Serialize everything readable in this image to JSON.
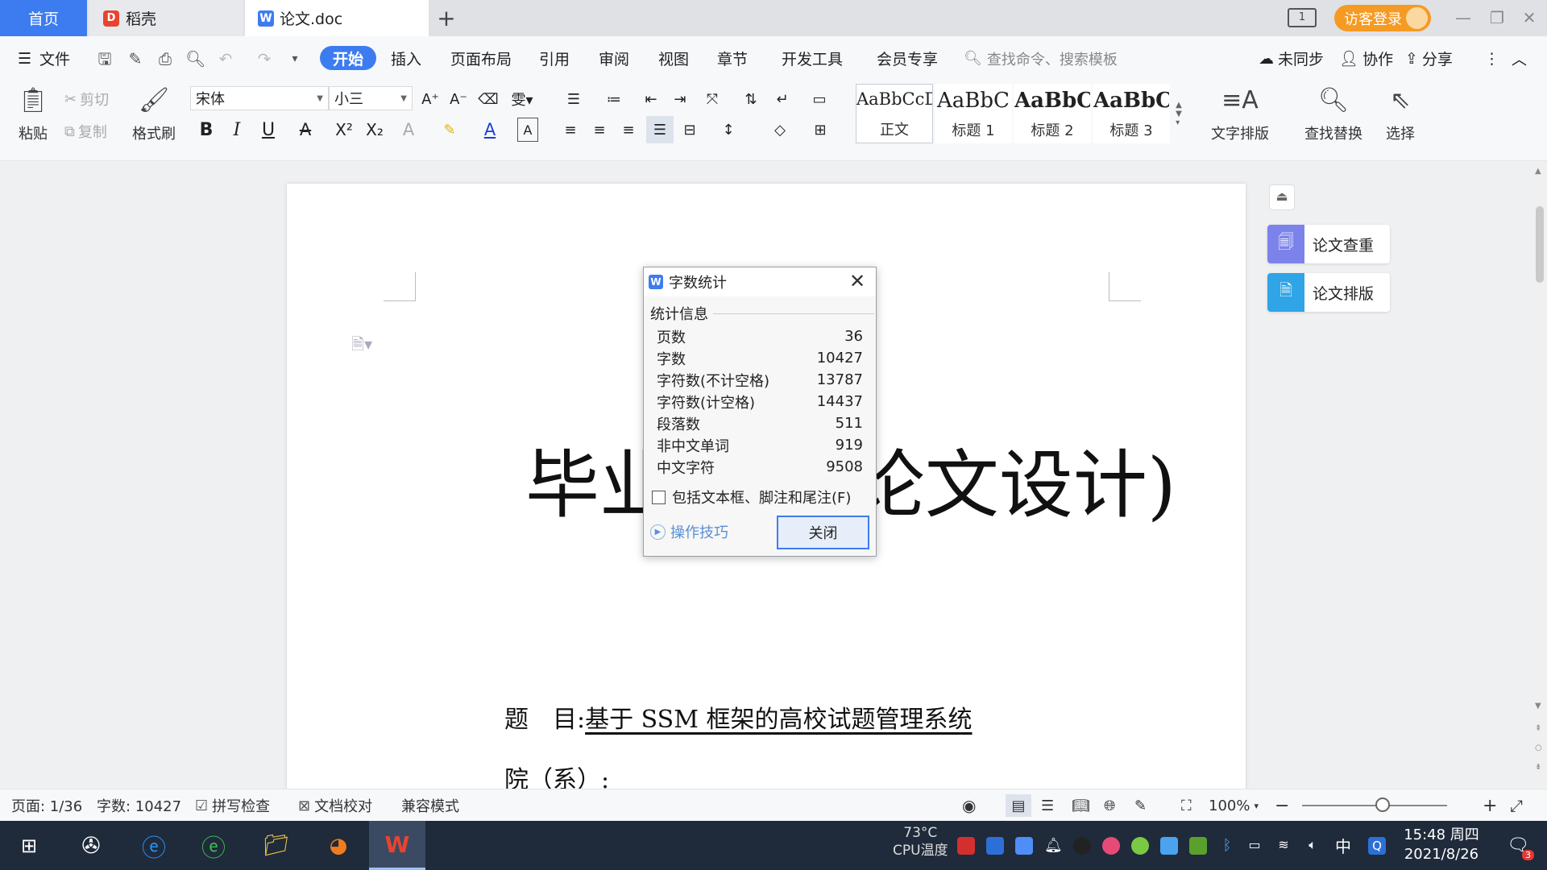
{
  "tabs": {
    "home": "首页",
    "daoke": "稻壳",
    "doc": "论文.doc"
  },
  "window": {
    "layout_label": "1",
    "visitor_login": "访客登录"
  },
  "menu": {
    "file": "文件",
    "items": [
      "开始",
      "插入",
      "页面布局",
      "引用",
      "审阅",
      "视图",
      "章节",
      "开发工具",
      "会员专享"
    ],
    "search_placeholder": "查找命令、搜索模板",
    "unsynced": "未同步",
    "collab": "协作",
    "share": "分享"
  },
  "ribbon": {
    "paste": "粘贴",
    "cut": "剪切",
    "copy": "复制",
    "format_painter": "格式刷",
    "font_name": "宋体",
    "font_size": "小三",
    "styles": [
      {
        "preview": "AaBbCcDd",
        "label": "正文"
      },
      {
        "preview": "AaBbC",
        "label": "标题 1"
      },
      {
        "preview": "AaBbC",
        "label": "标题 2"
      },
      {
        "preview": "AaBbC",
        "label": "标题 3"
      }
    ],
    "text_layout": "文字排版",
    "find_replace": "查找替换",
    "select": "选择"
  },
  "document": {
    "title": "毕业设计(论文设计)",
    "topic_label": "题　目:",
    "topic_value": "基于 SSM 框架的高校试题管理系统",
    "dept_label": "院（系）:",
    "dept_value": ""
  },
  "side_panel": {
    "check": "论文查重",
    "format": "论文排版"
  },
  "dialog": {
    "title": "字数统计",
    "group_label": "统计信息",
    "stats": [
      {
        "label": "页数",
        "value": "36"
      },
      {
        "label": "字数",
        "value": "10427"
      },
      {
        "label": "字符数(不计空格)",
        "value": "13787"
      },
      {
        "label": "字符数(计空格)",
        "value": "14437"
      },
      {
        "label": "段落数",
        "value": "511"
      },
      {
        "label": "非中文单词",
        "value": "919"
      },
      {
        "label": "中文字符",
        "value": "9508"
      }
    ],
    "include_label": "包括文本框、脚注和尾注(F)",
    "tips": "操作技巧",
    "close_button": "关闭"
  },
  "status": {
    "page": "页面: 1/36",
    "words": "字数: 10427",
    "spell_check": "拼写检查",
    "doc_proof": "文档校对",
    "compat_mode": "兼容模式",
    "zoom": "100%"
  },
  "taskbar": {
    "cpu_temp": "73°C",
    "cpu_label": "CPU温度",
    "ime": "中",
    "time": "15:48 周四",
    "date": "2021/8/26",
    "notify_count": "3"
  },
  "colors": {
    "accent": "#3d7cf0",
    "visitor": "#f59a23",
    "taskbar": "#1f2a3a"
  }
}
